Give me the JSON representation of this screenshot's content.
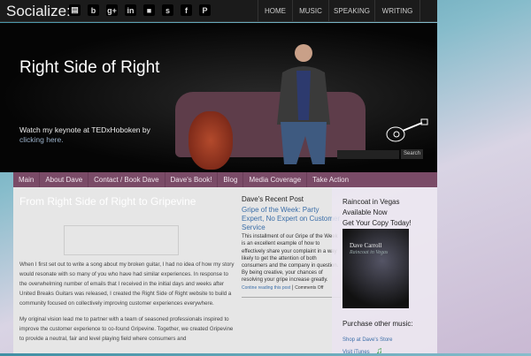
{
  "topbar": {
    "socialize": "Socialize:",
    "social_icons": [
      "youtube-icon",
      "blogger-icon",
      "google-plus-icon",
      "linkedin-icon",
      "myspace-icon",
      "stumbleupon-icon",
      "facebook-icon",
      "pinterest-icon"
    ],
    "social_glyphs": [
      "▤",
      "b",
      "g+",
      "in",
      "■",
      "s",
      "f",
      "P"
    ],
    "nav": [
      "HOME",
      "MUSIC",
      "SPEAKING",
      "WRITING"
    ]
  },
  "hero": {
    "title": "Right Side of Right",
    "keynote": "Watch my keynote at TEDxHoboken by",
    "keynote_link": "clicking here.",
    "search_button": "Search"
  },
  "nav": [
    "Main",
    "About Dave",
    "Contact / Book Dave",
    "Dave's Book!",
    "Blog",
    "Media Coverage",
    "Take Action"
  ],
  "post": {
    "title": "From Right Side of Right to Gripevine",
    "paragraphs": [
      "When I first set out to write a song about my broken guitar, I had no idea of how my story would resonate with so many of you who have had similar experiences.  In response to the overwhelming number of emails that I received in the initial days and weeks after United Breaks Guitars was released,  I created the Right Side of Right website to build a community focused on collectively improving customer experiences everywhere.",
      "My original vision lead me to partner with a team of seasoned professionals inspired to improve the customer experience to co-found Gripevine.   Together, we created Gripevine to provide a neutral, fair and level playing field where consumers and"
    ]
  },
  "recent": {
    "heading": "Dave's Recent Post",
    "post_title": "Gripe of the Week: Party Expert, No Expert on Customer Service",
    "excerpt": "This installment of our Gripe of the Week is an excellent example of how to effectively share your complaint in a way likely to get the attention of both consumers and the company in question. By being creative, your chances of resolving your gripe increase greatly.",
    "continue": "Contine reading this post",
    "comments": "Comments Off"
  },
  "sidebar": {
    "line1": "Raincoat in Vegas",
    "line2": "Available Now",
    "line3": "Get Your Copy Today!",
    "album_artist": "Dave Carroll",
    "album_title": "Raincoat in Vegas",
    "purchase": "Purchase other music:",
    "store": "Shop at Dave's Store",
    "itunes": "Visit iTunes"
  }
}
